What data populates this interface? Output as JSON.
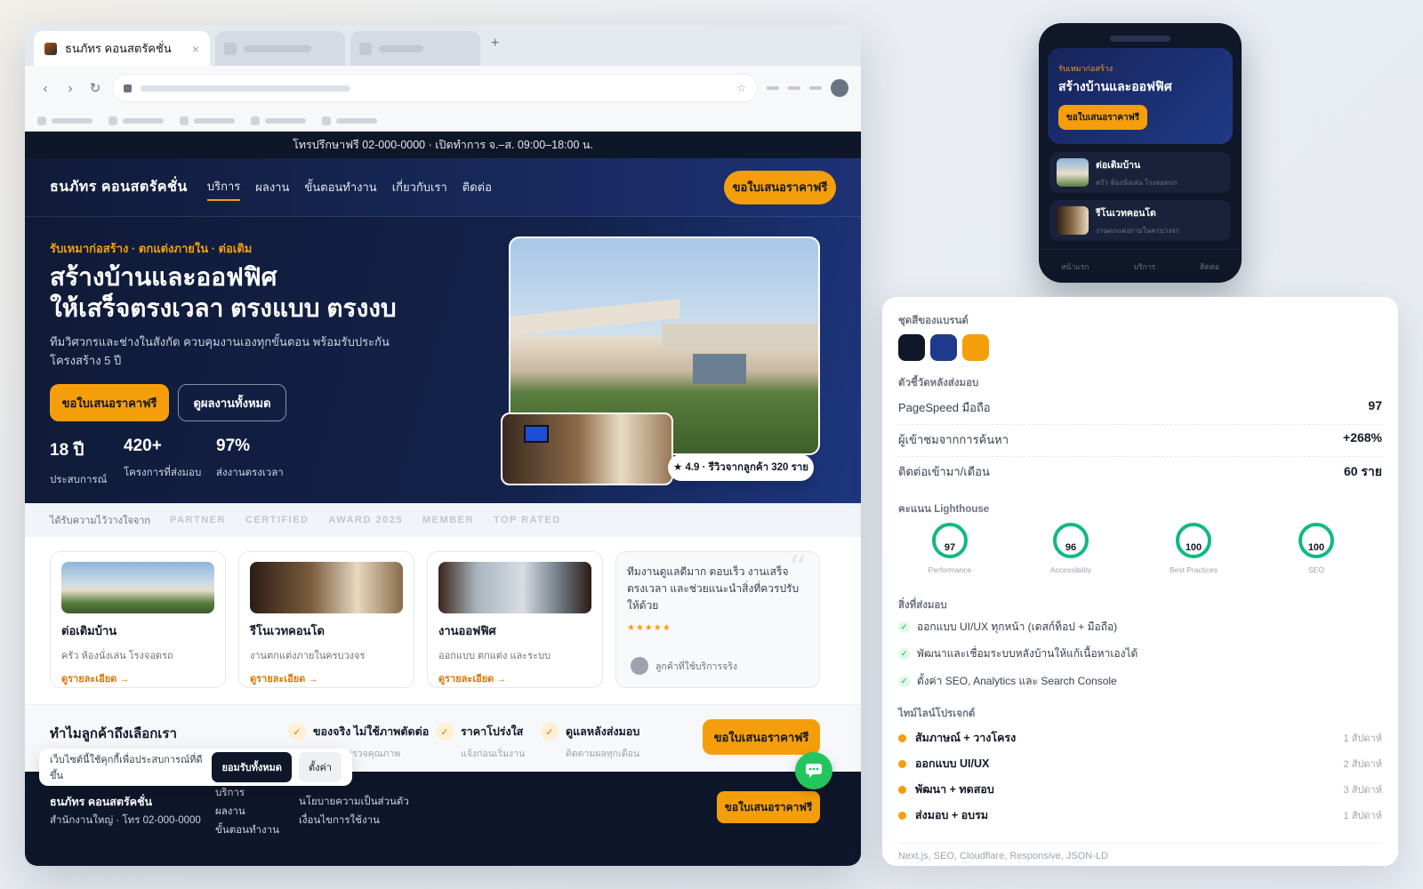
{
  "browser": {
    "tab_title": "ธนภัทร คอนสตรัคชั่น",
    "tab_close": "×",
    "new_tab": "+"
  },
  "site": {
    "topbar": "โทรปรึกษาฟรี 02-000-0000 · เปิดทำการ จ.–ส. 09:00–18:00 น.",
    "logo": "ธนภัทร คอนสตรัคชั่น",
    "nav": [
      "บริการ",
      "ผลงาน",
      "ขั้นตอนทำงาน",
      "เกี่ยวกับเรา",
      "ติดต่อ"
    ],
    "nav_cta": "ขอใบเสนอราคาฟรี",
    "hero": {
      "kicker": "รับเหมาก่อสร้าง · ตกแต่งภายใน · ต่อเติม",
      "title_line1": "สร้างบ้านและออฟฟิศ",
      "title_line2": "ให้เสร็จตรงเวลา ตรงแบบ ตรงงบ",
      "lead": "ทีมวิศวกรและช่างในสังกัด ควบคุมงานเองทุกขั้นตอน พร้อมรับประกันโครงสร้าง 5 ปี",
      "cta_primary": "ขอใบเสนอราคาฟรี",
      "cta_secondary": "ดูผลงานทั้งหมด",
      "stats": [
        {
          "value": "18 ปี",
          "label": "ประสบการณ์"
        },
        {
          "value": "420+",
          "label": "โครงการที่ส่งมอบ"
        },
        {
          "value": "97%",
          "label": "ส่งงานตรงเวลา"
        }
      ],
      "rating": "★ 4.9 · รีวิวจากลูกค้า 320 ราย"
    },
    "trust": {
      "label": "ได้รับความไว้วางใจจาก",
      "partners": [
        "PARTNER",
        "CERTIFIED",
        "AWARD 2025",
        "MEMBER",
        "TOP RATED"
      ]
    },
    "services": [
      {
        "title": "ต่อเติมบ้าน",
        "desc": "ครัว ห้องนั่งเล่น โรงจอดรถ",
        "more": "ดูรายละเอียด →"
      },
      {
        "title": "รีโนเวทคอนโด",
        "desc": "งานตกแต่งภายในครบวงจร",
        "more": "ดูรายละเอียด →"
      },
      {
        "title": "งานออฟฟิศ",
        "desc": "ออกแบบ ตกแต่ง และระบบ",
        "more": "ดูรายละเอียด →"
      }
    ],
    "testimonial": {
      "quote": "ทีมงานดูแลดีมาก ตอบเร็ว งานเสร็จตรงเวลา และช่วยแนะนำสิ่งที่ควรปรับให้ด้วย",
      "stars": "★★★★★",
      "author": "ลูกค้าที่ใช้บริการจริง",
      "quote_mark": "“"
    },
    "why": {
      "title": "ทำไมลูกค้าถึงเลือกเรา",
      "points": [
        {
          "title": "ของจริง ไม่ใช้ภาพตัดต่อ",
          "desc": "ผ่านการตรวจคุณภาพ"
        },
        {
          "title": "ราคาโปร่งใส",
          "desc": "แจ้งก่อนเริ่มงาน"
        },
        {
          "title": "ดูแลหลังส่งมอบ",
          "desc": "ติดตามผลทุกเดือน"
        }
      ],
      "cta": "ขอใบเสนอราคาฟรี"
    },
    "footer": {
      "brand": "ธนภัทร คอนสตรัคชั่น",
      "address": "สำนักงานใหญ่ · โทร 02-000-0000",
      "links1": [
        "บริการ",
        "ผลงาน",
        "ขั้นตอนทำงาน"
      ],
      "links2": [
        "นโยบายความเป็นส่วนตัว",
        "เงื่อนไขการใช้งาน"
      ],
      "cta": "ขอใบเสนอราคาฟรี"
    },
    "cookie": {
      "text": "เว็บไซต์นี้ใช้คุกกี้เพื่อประสบการณ์ที่ดีขึ้น",
      "accept": "ยอมรับทั้งหมด",
      "settings": "ตั้งค่า"
    }
  },
  "phone": {
    "kicker": "รับเหมาก่อสร้าง",
    "title": "สร้างบ้านและออฟฟิศ",
    "cta": "ขอใบเสนอราคาฟรี",
    "cards": [
      {
        "title": "ต่อเติมบ้าน",
        "desc": "ครัว ห้องนั่งเล่น โรงจอดรถ"
      },
      {
        "title": "รีโนเวทคอนโด",
        "desc": "งานตกแต่งภายในครบวงจร"
      }
    ],
    "tabs": [
      "หน้าแรก",
      "บริการ",
      "ติดต่อ"
    ]
  },
  "panel": {
    "brand_label": "ชุดสีของแบรนด์",
    "colors": [
      "#0f1729",
      "#1e3a8a",
      "#f59e0b"
    ],
    "metrics_label": "ตัวชี้วัดหลังส่งมอบ",
    "metrics": [
      {
        "label": "PageSpeed มือถือ",
        "value": "97"
      },
      {
        "label": "ผู้เข้าชมจากการค้นหา",
        "value": "+268%"
      },
      {
        "label": "ติดต่อเข้ามา/เดือน",
        "value": "60 ราย"
      }
    ],
    "lighthouse_label": "คะแนน Lighthouse",
    "lighthouse": [
      {
        "score": "97",
        "name": "Performance"
      },
      {
        "score": "96",
        "name": "Accessibility"
      },
      {
        "score": "100",
        "name": "Best Practices"
      },
      {
        "score": "100",
        "name": "SEO"
      }
    ],
    "deliver_label": "สิ่งที่ส่งมอบ",
    "deliverables": [
      "ออกแบบ UI/UX ทุกหน้า (เดสก์ท็อป + มือถือ)",
      "พัฒนาและเชื่อมระบบหลังบ้านให้แก้เนื้อหาเองได้",
      "ตั้งค่า SEO, Analytics และ Search Console"
    ],
    "timeline_label": "ไทม์ไลน์โปรเจกต์",
    "timeline": [
      {
        "step": "สัมภาษณ์ + วางโครง",
        "dur": "1 สัปดาห์"
      },
      {
        "step": "ออกแบบ UI/UX",
        "dur": "2 สัปดาห์"
      },
      {
        "step": "พัฒนา + ทดสอบ",
        "dur": "3 สัปดาห์"
      },
      {
        "step": "ส่งมอบ + อบรม",
        "dur": "1 สัปดาห์"
      }
    ],
    "stack": "Next.js, SEO, Cloudflare, Responsive, JSON-LD"
  }
}
